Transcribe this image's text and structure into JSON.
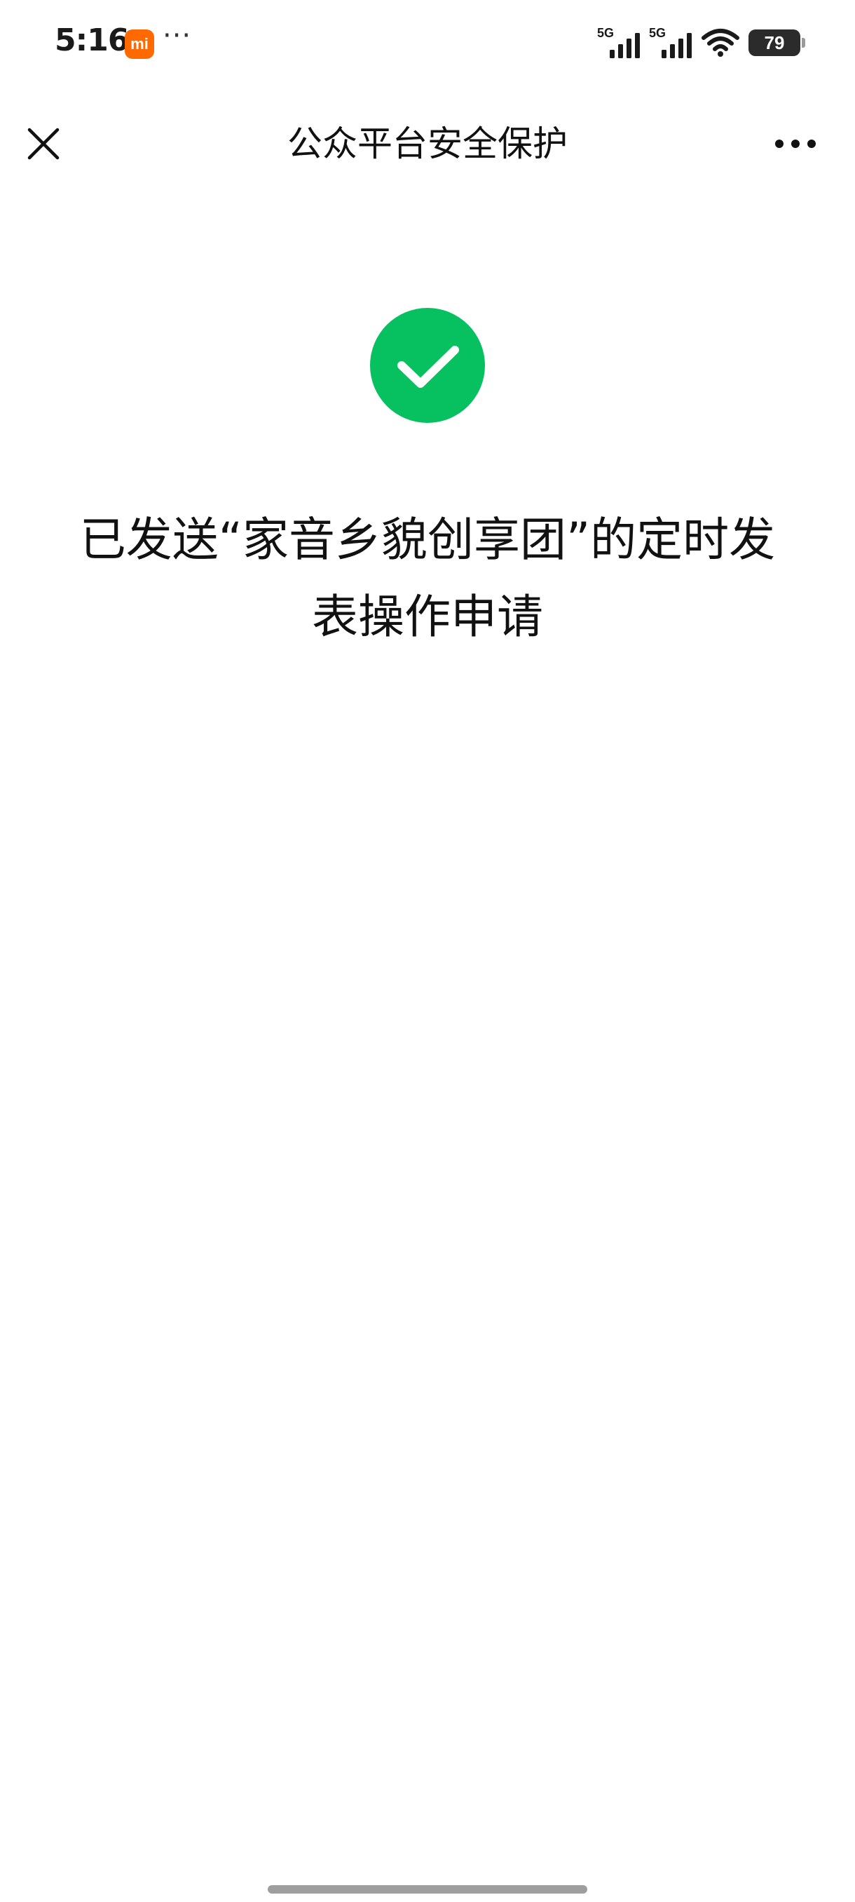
{
  "status_bar": {
    "time": "5:16",
    "badge_text": "mi",
    "more_text": "···",
    "signal_1_label": "5G",
    "signal_2_label": "5G",
    "battery_level": "79",
    "badge_color": "#ff6a00"
  },
  "nav": {
    "title": "公众平台安全保护",
    "close_icon": "close-icon",
    "more_icon": "more-icon"
  },
  "result": {
    "icon": "success-check-icon",
    "icon_color": "#07c160",
    "message": "已发送“家音乡貌创享团”的定时发表操作申请"
  }
}
